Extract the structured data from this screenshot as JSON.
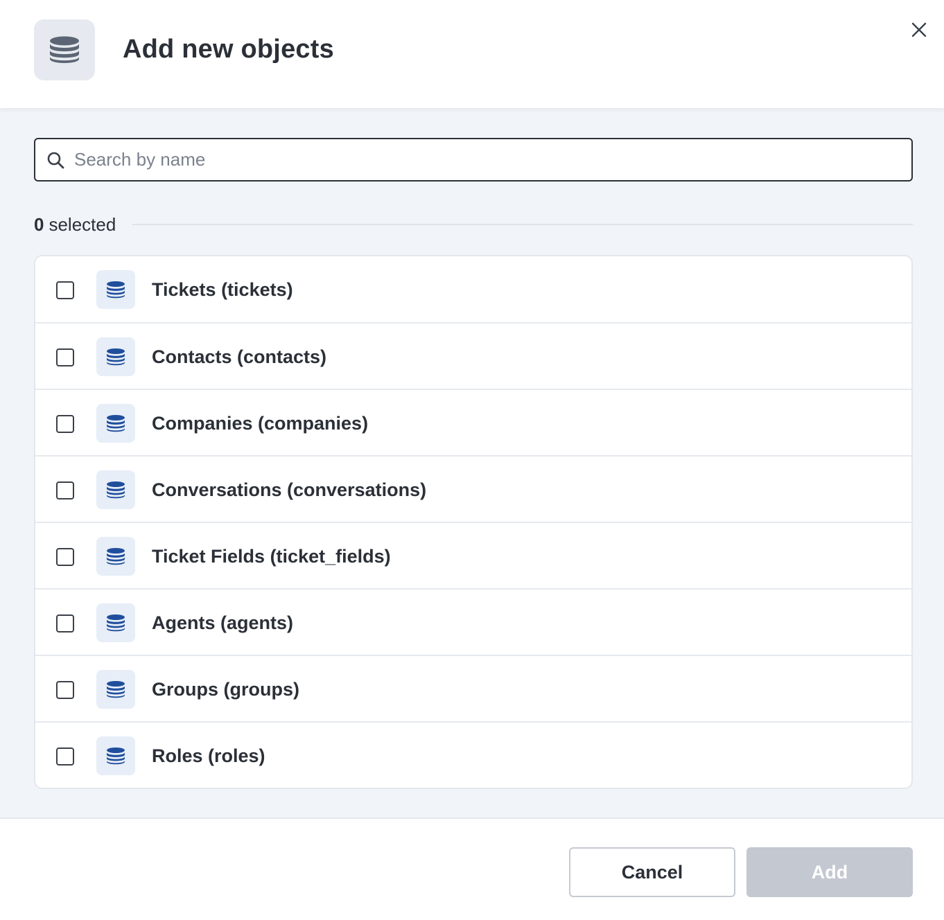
{
  "dialog": {
    "title": "Add new objects",
    "header_icon": "database-icon",
    "close_icon": "close-icon"
  },
  "search": {
    "placeholder": "Search by name",
    "value": "",
    "icon": "search-icon"
  },
  "selection": {
    "count": "0",
    "label": "selected"
  },
  "objects": [
    {
      "label": "Tickets (tickets)",
      "checked": false,
      "icon": "database-icon"
    },
    {
      "label": "Contacts (contacts)",
      "checked": false,
      "icon": "database-icon"
    },
    {
      "label": "Companies (companies)",
      "checked": false,
      "icon": "database-icon"
    },
    {
      "label": "Conversations (conversations)",
      "checked": false,
      "icon": "database-icon"
    },
    {
      "label": "Ticket Fields (ticket_fields)",
      "checked": false,
      "icon": "database-icon"
    },
    {
      "label": "Agents (agents)",
      "checked": false,
      "icon": "database-icon"
    },
    {
      "label": "Groups (groups)",
      "checked": false,
      "icon": "database-icon"
    },
    {
      "label": "Roles (roles)",
      "checked": false,
      "icon": "database-icon"
    }
  ],
  "footer": {
    "cancel_label": "Cancel",
    "add_label": "Add",
    "add_disabled": true
  },
  "colors": {
    "row_icon": "#1f4e9c",
    "header_icon": "#5c6573",
    "add_disabled_bg": "#c3c8d1"
  }
}
